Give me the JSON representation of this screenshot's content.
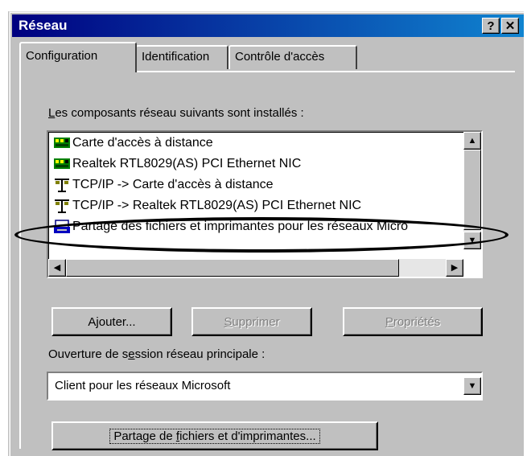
{
  "window": {
    "title": "Réseau",
    "help_label": "?",
    "close_label": "✕"
  },
  "tabs": [
    {
      "label": "Configuration",
      "active": true
    },
    {
      "label": "Identification",
      "active": false
    },
    {
      "label": "Contrôle d'accès",
      "active": false
    }
  ],
  "components": {
    "label_underlined": "L",
    "label_rest": "es composants réseau suivants sont installés :",
    "items": [
      {
        "icon": "network-adapter-icon",
        "label": "Carte d'accès à distance"
      },
      {
        "icon": "network-adapter-icon",
        "label": "Realtek RTL8029(AS) PCI Ethernet NIC"
      },
      {
        "icon": "protocol-icon",
        "label": "TCP/IP -> Carte d'accès à distance"
      },
      {
        "icon": "protocol-icon",
        "label": "TCP/IP -> Realtek RTL8029(AS) PCI Ethernet NIC"
      },
      {
        "icon": "file-printer-sharing-icon",
        "label": "Partage des fichiers et imprimantes pour les réseaux Micro"
      }
    ],
    "highlighted_item": "Partage des fichiers et imprimantes pour les réseaux Micro"
  },
  "buttons": {
    "add_pre": "A",
    "add_u": "j",
    "add_post": "outer...",
    "remove_u": "S",
    "remove_post": "upprimer",
    "properties_u": "P",
    "properties_post": "ropriétés"
  },
  "logon": {
    "label_pre": "Ouverture de s",
    "label_u": "e",
    "label_post": "ssion réseau principale :",
    "selected_value": "Client pour les réseaux Microsoft"
  },
  "sharing_button": {
    "pre": "Partage de ",
    "u": "f",
    "post": "ichiers et d'imprimantes..."
  },
  "colors": {
    "titlebar_start": "#000080",
    "titlebar_end": "#1084d0",
    "face": "#c0c0c0",
    "annotation": "#000000"
  }
}
